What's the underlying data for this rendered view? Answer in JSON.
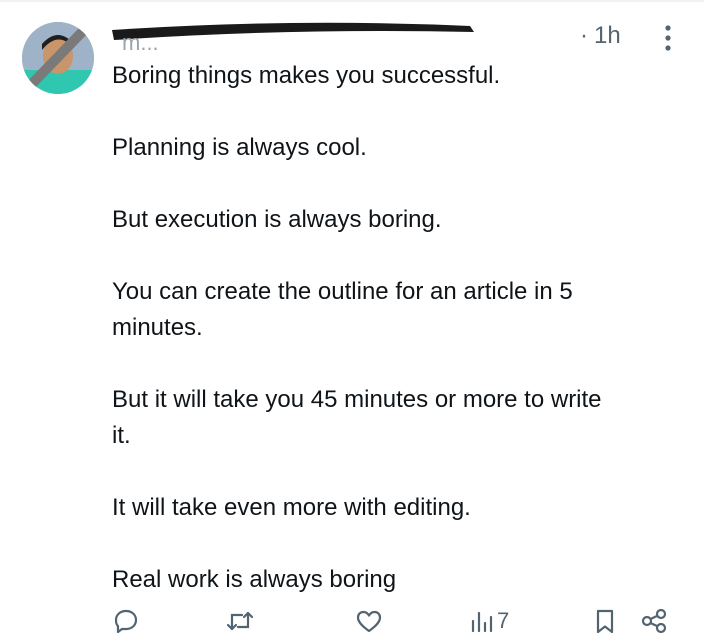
{
  "tweet": {
    "handle_visible_fragment": "@mkmichaelz",
    "separator": "·",
    "timestamp": "1h",
    "paragraphs": [
      "Boring things makes you successful.",
      "Planning is always cool.",
      "But execution is always boring.",
      "You can create the outline for an article in 5\nminutes.",
      "But it will take you 45 minutes or more to write\nit.",
      "It will take even more with editing.",
      "Real work is always boring"
    ]
  },
  "actions": {
    "reply_icon": "reply-icon",
    "retweet_icon": "retweet-icon",
    "like_icon": "heart-icon",
    "views_icon": "views-chart-icon",
    "views_count": "7",
    "bookmark_icon": "bookmark-icon",
    "share_icon": "share-icon"
  },
  "colors": {
    "text": "#0f1419",
    "secondary": "#536471",
    "redaction": "#7d7d7d"
  }
}
